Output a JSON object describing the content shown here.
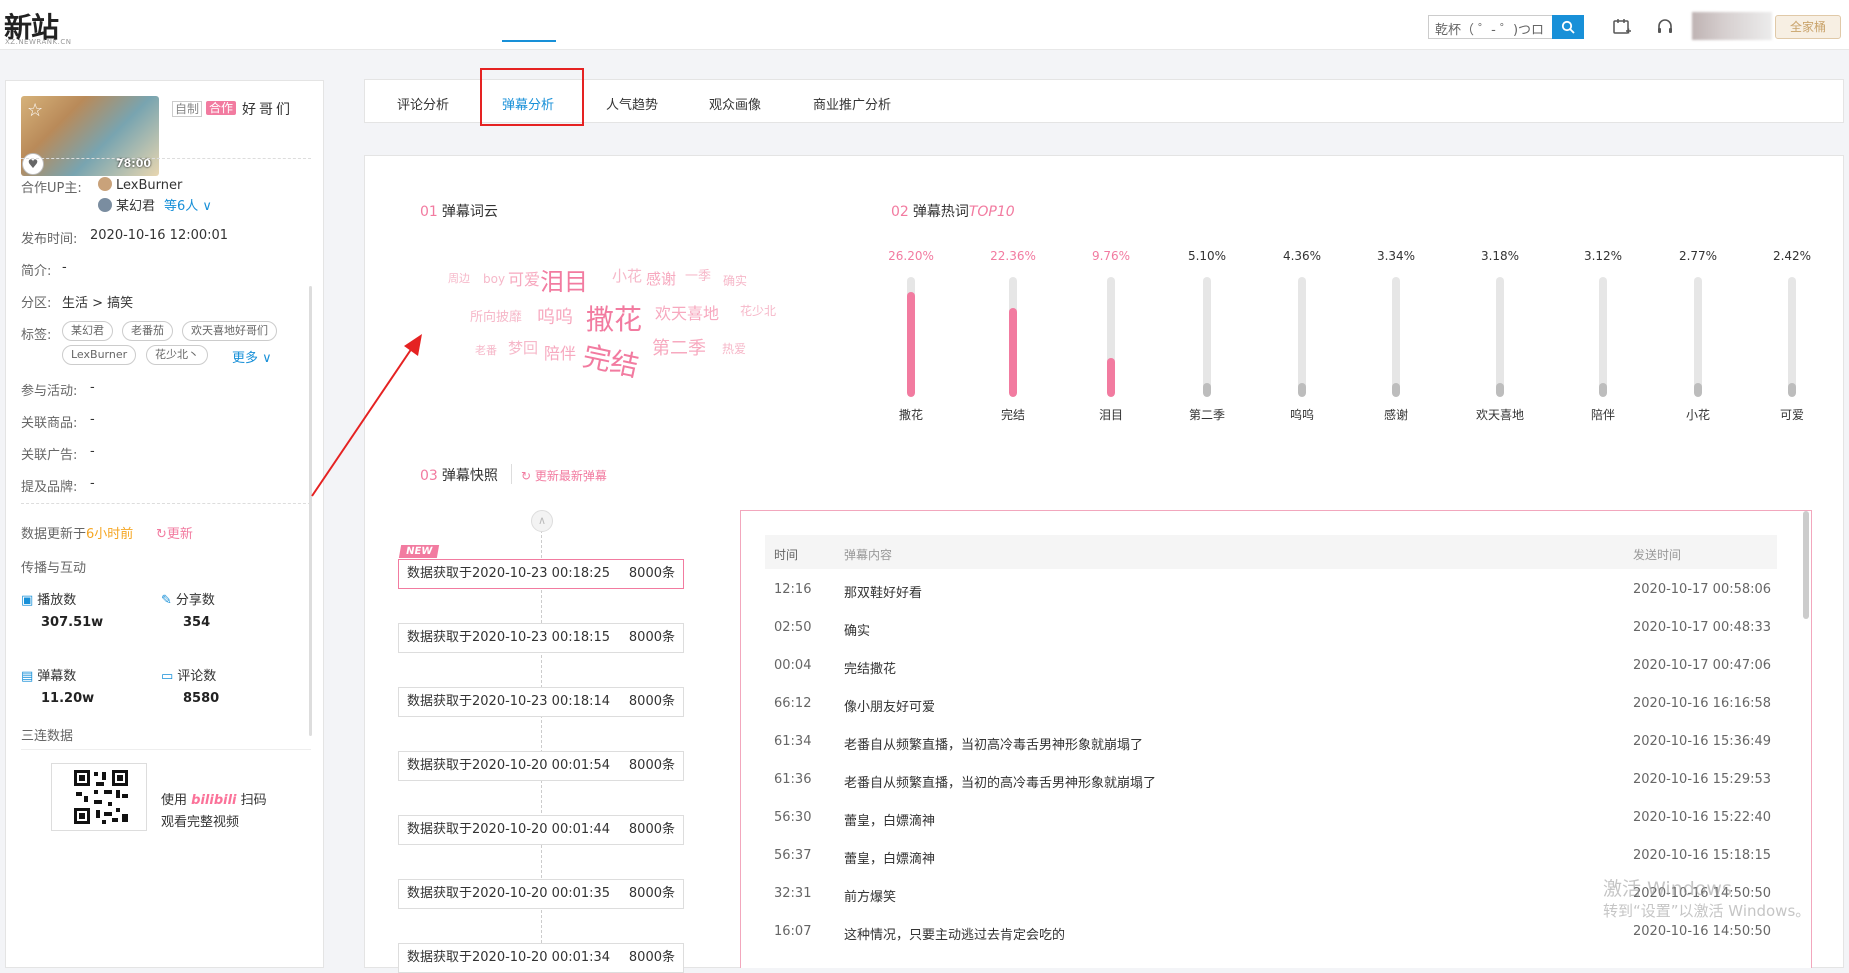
{
  "header": {
    "logo": "新站",
    "logo_sub": "XZ.NEWRANK.CN",
    "search_value": "乾杯（ ゜- ゜)つロ",
    "vip_label": "全家桶"
  },
  "tabs": [
    {
      "label": "评论分析"
    },
    {
      "label": "弹幕分析"
    },
    {
      "label": "人气趋势"
    },
    {
      "label": "观众画像"
    },
    {
      "label": "商业推广分析"
    }
  ],
  "video": {
    "duration": "78:00",
    "tag_self": "自制",
    "tag_coop": "合作",
    "title": "好哥们",
    "coop_label": "合作UP主:",
    "up1": "LexBurner",
    "up2": "某幻君",
    "up_more": "等6人",
    "publish_label": "发布时间:",
    "publish_time": "2020-10-16 12:00:01",
    "intro_label": "简介:",
    "intro": "-",
    "zone_label": "分区:",
    "zone": "生活 > 搞笑",
    "tags_label": "标签:",
    "tags": [
      "某幻君",
      "老番茄",
      "欢天喜地好哥们",
      "LexBurner",
      "花少北丶"
    ],
    "tags_more": "更多",
    "activity_label": "参与活动:",
    "activity": "-",
    "product_label": "关联商品:",
    "product": "-",
    "ad_label": "关联广告:",
    "ad": "-",
    "brand_label": "提及品牌:",
    "brand": "-",
    "update_prefix": "数据更新于",
    "update_time": "6小时前",
    "update_btn": "更新",
    "spread_title": "传播与互动",
    "stats": {
      "play_label": "播放数",
      "play": "307.51w",
      "share_label": "分享数",
      "share": "354",
      "danmaku_label": "弹幕数",
      "danmaku": "11.20w",
      "comment_label": "评论数",
      "comment": "8580"
    },
    "triple_title": "三连数据",
    "qr_text1_pre": "使用",
    "qr_brand": "bilibili",
    "qr_text1_post": "扫码",
    "qr_text2": "观看完整视频"
  },
  "sections": {
    "s1_num": "01",
    "s1_title": "弹幕词云",
    "s2_num": "02",
    "s2_title": "弹幕热词",
    "s2_suffix": "TOP10",
    "s3_num": "03",
    "s3_title": "弹幕快照",
    "s3_refresh": "更新最新弹幕"
  },
  "wordcloud": [
    {
      "w": "周边"
    },
    {
      "w": "boy"
    },
    {
      "w": "可爱"
    },
    {
      "w": "泪目"
    },
    {
      "w": "小花"
    },
    {
      "w": "感谢"
    },
    {
      "w": "一季"
    },
    {
      "w": "确实"
    },
    {
      "w": "所向披靡"
    },
    {
      "w": "呜呜"
    },
    {
      "w": "撒花"
    },
    {
      "w": "欢天喜地"
    },
    {
      "w": "花少北"
    },
    {
      "w": "老番"
    },
    {
      "w": "梦回"
    },
    {
      "w": "陪伴"
    },
    {
      "w": "完结"
    },
    {
      "w": "第二季"
    },
    {
      "w": "热爱"
    }
  ],
  "colors": {
    "accent_pink": "#f27ba0",
    "accent_blue": "#1890d8",
    "bar_track": "#e6e6e6",
    "bar_grey": "#bdbdbd"
  },
  "chart_data": {
    "type": "bar",
    "title": "弹幕热词TOP10",
    "categories": [
      "撒花",
      "完结",
      "泪目",
      "第二季",
      "呜呜",
      "感谢",
      "欢天喜地",
      "陪伴",
      "小花",
      "可爱"
    ],
    "values": [
      26.2,
      22.36,
      9.76,
      5.1,
      4.36,
      3.34,
      3.18,
      3.12,
      2.77,
      2.42
    ],
    "labels": [
      "26.20%",
      "22.36%",
      "9.76%",
      "5.10%",
      "4.36%",
      "3.34%",
      "3.18%",
      "3.12%",
      "2.77%",
      "2.42%"
    ],
    "ylim": [
      0,
      30
    ]
  },
  "snapshots": {
    "new_tag": "NEW",
    "items": [
      {
        "text": "数据获取于2020-10-23 00:18:25",
        "count": "8000条"
      },
      {
        "text": "数据获取于2020-10-23 00:18:15",
        "count": "8000条"
      },
      {
        "text": "数据获取于2020-10-23 00:18:14",
        "count": "8000条"
      },
      {
        "text": "数据获取于2020-10-20 00:01:54",
        "count": "8000条"
      },
      {
        "text": "数据获取于2020-10-20 00:01:44",
        "count": "8000条"
      },
      {
        "text": "数据获取于2020-10-20 00:01:35",
        "count": "8000条"
      },
      {
        "text": "数据获取于2020-10-20 00:01:34",
        "count": "8000条"
      }
    ]
  },
  "table": {
    "headers": [
      "时间",
      "弹幕内容",
      "发送时间"
    ],
    "rows": [
      [
        "12:16",
        "那双鞋好好看",
        "2020-10-17 00:58:06"
      ],
      [
        "02:50",
        "确实",
        "2020-10-17 00:48:33"
      ],
      [
        "00:04",
        "完结撒花",
        "2020-10-17 00:47:06"
      ],
      [
        "66:12",
        "像小朋友好可爱",
        "2020-10-16 16:16:58"
      ],
      [
        "61:34",
        "老番自从频繁直播，当初高冷毒舌男神形象就崩塌了",
        "2020-10-16 15:36:49"
      ],
      [
        "61:36",
        "老番自从频繁直播，当初的高冷毒舌男神形象就崩塌了",
        "2020-10-16 15:29:53"
      ],
      [
        "56:30",
        "蕾皇，白嫖滴神",
        "2020-10-16 15:22:40"
      ],
      [
        "56:37",
        "蕾皇，白嫖滴神",
        "2020-10-16 15:18:15"
      ],
      [
        "32:31",
        "前方爆笑",
        "2020-10-16 14:50:50"
      ],
      [
        "16:07",
        "这种情况，只要主动逃过去肯定会吃的",
        "2020-10-16 14:50:50"
      ]
    ]
  },
  "watermark": {
    "line1": "激活 Windows",
    "line2": "转到“设置”以激活 Windows。"
  }
}
